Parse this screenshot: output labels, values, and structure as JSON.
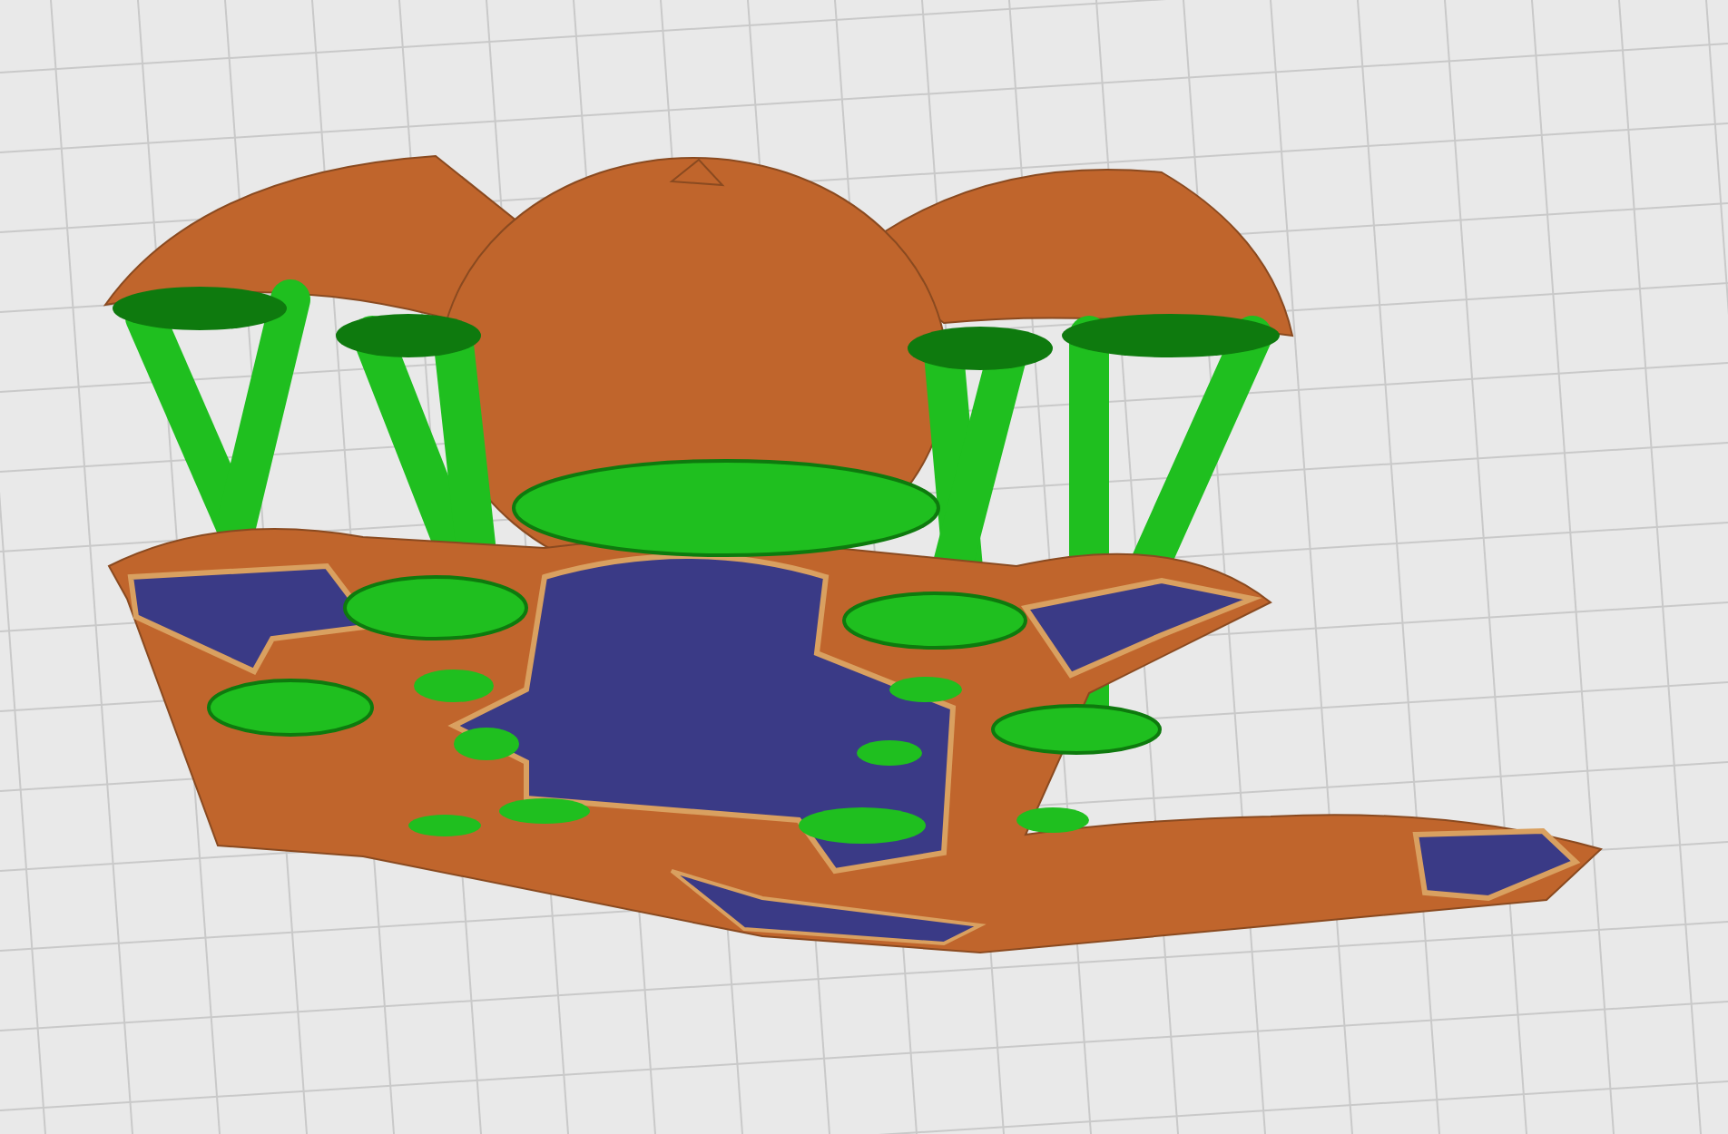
{
  "viewport": {
    "kind": "layer-preview"
  }
}
